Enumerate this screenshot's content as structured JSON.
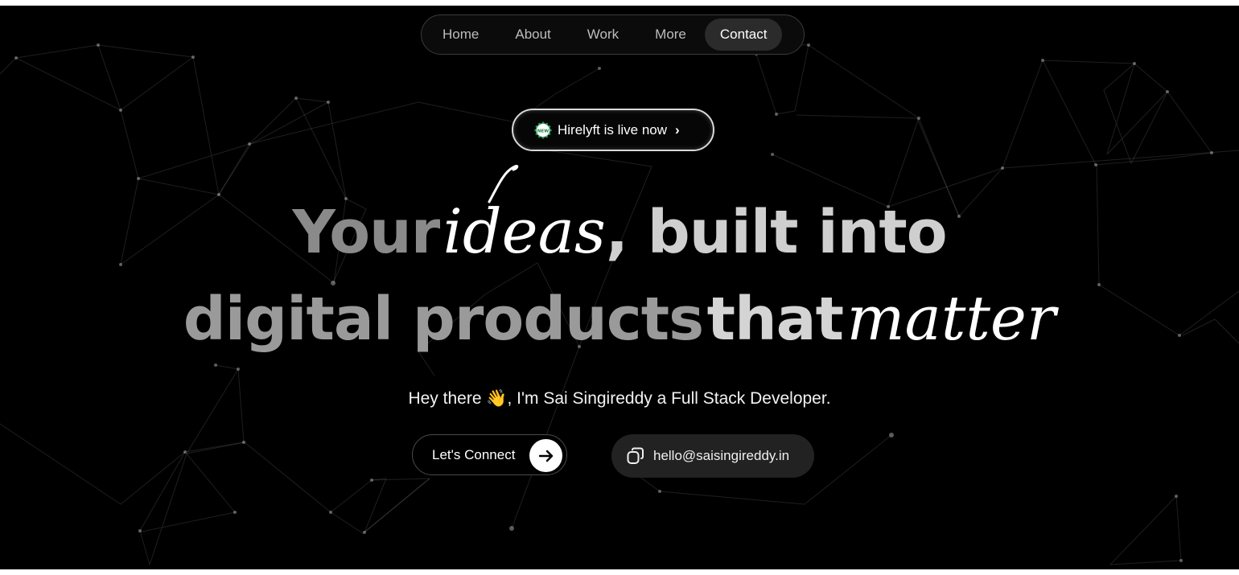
{
  "nav": {
    "items": [
      {
        "label": "Home"
      },
      {
        "label": "About"
      },
      {
        "label": "Work"
      },
      {
        "label": "More"
      },
      {
        "label": "Contact"
      }
    ],
    "active": "Contact"
  },
  "badge": {
    "seal_text": "NEW",
    "text": "Hirelyft is live now",
    "chevron": "›",
    "seal_color": "#2e9e5b"
  },
  "hero": {
    "line1": {
      "w1": "Your",
      "w2": "ideas",
      "w3": ", built into"
    },
    "line2": {
      "w1": "digital products",
      "w2": "that",
      "w3": "matter"
    }
  },
  "intro": {
    "prefix": "Hey there ",
    "emoji": "👋",
    "suffix": ", I'm Sai Singireddy a Full Stack Developer."
  },
  "cta": {
    "connect_label": "Let's Connect",
    "email": "hello@saisingireddy.in",
    "icons": {
      "connect": "arrow-right-icon",
      "email": "copy-icon"
    }
  },
  "theme": {
    "background": "#000000",
    "accent": "#ffffff"
  }
}
